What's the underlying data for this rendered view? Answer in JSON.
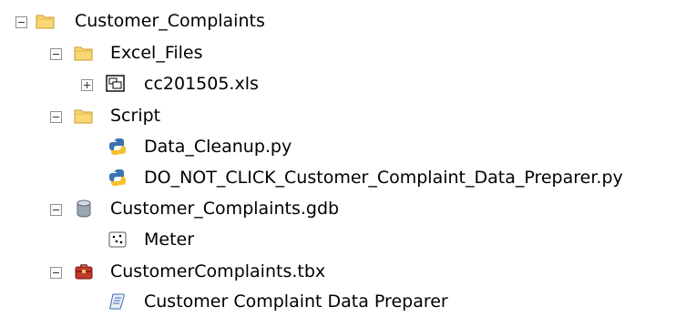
{
  "tree": {
    "root": {
      "label": "Customer_Complaints",
      "icon": "folder-icon",
      "expanded": true
    },
    "excel_files": {
      "label": "Excel_Files",
      "icon": "folder-icon",
      "expanded": true
    },
    "xls_file": {
      "label": "cc201505.xls",
      "icon": "excel-table-icon",
      "expanded": false
    },
    "script": {
      "label": "Script",
      "icon": "folder-icon",
      "expanded": true
    },
    "data_cleanup": {
      "label": "Data_Cleanup.py",
      "icon": "python-icon"
    },
    "do_not_click": {
      "label": "DO_NOT_CLICK_Customer_Complaint_Data_Preparer.py",
      "icon": "python-icon"
    },
    "gdb": {
      "label": "Customer_Complaints.gdb",
      "icon": "geodatabase-icon",
      "expanded": true
    },
    "meter": {
      "label": "Meter",
      "icon": "point-feature-class-icon"
    },
    "tbx": {
      "label": "CustomerComplaints.tbx",
      "icon": "toolbox-icon",
      "expanded": true
    },
    "tool": {
      "label": "Customer Complaint Data Preparer",
      "icon": "script-tool-icon"
    }
  },
  "colors": {
    "folder_fill": "#f8d775",
    "folder_stroke": "#c79c2a",
    "toggle_border": "#8f8f8f",
    "python_blue": "#3a74b0",
    "python_yellow": "#f5c22e",
    "toolbox_red": "#c0392b"
  }
}
